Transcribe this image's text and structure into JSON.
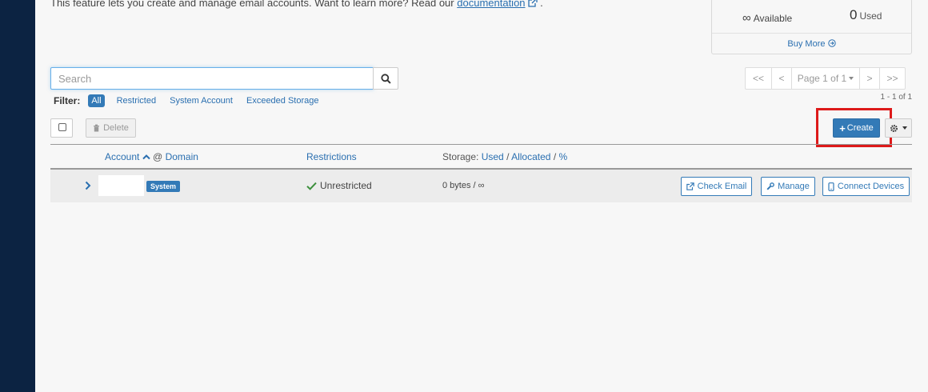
{
  "intro": {
    "text": "This feature lets you create and manage email accounts. Want to learn more? Read our",
    "link": "documentation",
    "trailing": "."
  },
  "stats": {
    "available_symbol": "∞",
    "available_label": "Available",
    "used_value": "0",
    "used_label": "Used",
    "buy_more": "Buy More"
  },
  "search": {
    "placeholder": "Search",
    "value": ""
  },
  "pagination": {
    "first": "<<",
    "prev": "<",
    "page": "Page 1 of 1",
    "next": ">",
    "last": ">>",
    "range": "1 - 1 of 1"
  },
  "filter": {
    "label": "Filter:",
    "options": [
      "All",
      "Restricted",
      "System Account",
      "Exceeded Storage"
    ],
    "active": "All"
  },
  "toolbar": {
    "delete": "Delete",
    "create": "Create"
  },
  "table": {
    "col_account": "Account",
    "col_at": "@",
    "col_domain": "Domain",
    "col_restrictions": "Restrictions",
    "col_storage_prefix": "Storage:",
    "col_storage_used": "Used",
    "col_storage_sep1": "/",
    "col_storage_allocated": "Allocated",
    "col_storage_sep2": "/",
    "col_storage_pct": "%",
    "rows": [
      {
        "badge": "System",
        "restriction": "Unrestricted",
        "storage": "0 bytes / ∞",
        "actions": {
          "check_email": "Check Email",
          "manage": "Manage",
          "connect": "Connect Devices"
        }
      }
    ]
  },
  "colors": {
    "sidebar": "#0c2342",
    "primary": "#337ab7",
    "link": "#2a6fb0",
    "highlight": "#dd1a1a",
    "check": "#3c8f3c"
  }
}
